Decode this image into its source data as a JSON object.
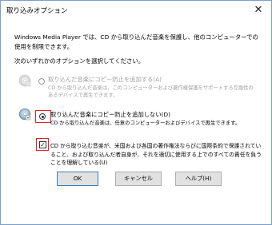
{
  "title": "取り込みオプション",
  "icons": {
    "close": "close-icon",
    "disc": "cd-disc-icon"
  },
  "intro_text": "Windows Media Player では、CD から取り込んだ音楽を保護し、他のコンピューターでの使用を制限できます。",
  "choose_text": "次のいずれかのオプションを選択してください。",
  "option_protect": {
    "label": "取り込んだ音楽にコピー防止を追加する(A)",
    "description": "CD から取り込んだ音楽は、このコンピューターおよび著作権保護をサポートする互換性のあるデバイスで再生できます。",
    "selected": false,
    "enabled": false
  },
  "option_no_protect": {
    "label": "取り込んだ音楽にコピー防止を追加しない(D)",
    "description": "CD から取り込んだ音楽は、任意のコンピューターおよびデバイスで再生できます。",
    "selected": true,
    "enabled": true
  },
  "acknowledge": {
    "checked": true,
    "text": "CD から取り込む音楽が、米国および各国の著作権法ならびに国際条約で保護されていること、および取り込んだ者自身が、それを適切に使用する上でのすべての責任を負うことを理解している(U)"
  },
  "buttons": {
    "ok": "OK",
    "cancel": "キャンセル",
    "help": "ヘルプ(H)"
  },
  "colors": {
    "highlight_border": "#e0232a",
    "window_border": "#7a9fc9"
  }
}
